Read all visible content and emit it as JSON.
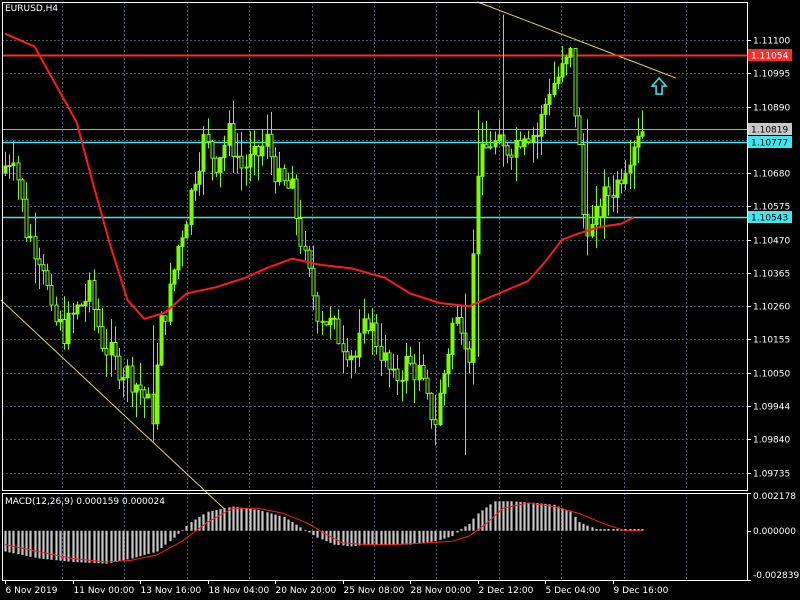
{
  "symbol_label": "EURUSD,H4",
  "colors": {
    "background": "#000000",
    "grid": "#4a5a6e",
    "axis": "#ffffff",
    "candle": "#7cfc00",
    "moving_average": "#ff1a1a",
    "trendline": "#e6d84a",
    "level_red": "#ff2a2a",
    "level_cyan": "#3fe8f0",
    "level_grey": "#a8a8a8",
    "arrow": "#2fe0e8",
    "macd_hist": "#c8c8c8",
    "macd_signal": "#ff1a1a",
    "text": "#ffffff"
  },
  "chart_data": [
    {
      "type": "candlestick",
      "title": "EURUSD,H4",
      "ylim": [
        1.0968,
        1.1122
      ],
      "y_ticks": [
        "1.11100",
        "1.10995",
        "1.10890",
        "1.10785",
        "1.10680",
        "1.10575",
        "1.10470",
        "1.10365",
        "1.10260",
        "1.10155",
        "1.10050",
        "1.09944",
        "1.09840",
        "1.09735"
      ],
      "x_ticks": [
        {
          "label": "6 Nov 2019",
          "bar": 0
        },
        {
          "label": "11 Nov 00:00",
          "bar": 16
        },
        {
          "label": "13 Nov 16:00",
          "bar": 32
        },
        {
          "label": "18 Nov 04:00",
          "bar": 48
        },
        {
          "label": "20 Nov 20:00",
          "bar": 64
        },
        {
          "label": "25 Nov 08:00",
          "bar": 80
        },
        {
          "label": "28 Nov 00:00",
          "bar": 96
        },
        {
          "label": "2 Dec 12:00",
          "bar": 112
        },
        {
          "label": "5 Dec 04:00",
          "bar": 128
        },
        {
          "label": "9 Dec 16:00",
          "bar": 144
        }
      ],
      "price_path": [
        [
          0,
          1.1068
        ],
        [
          3,
          1.1075
        ],
        [
          6,
          1.105
        ],
        [
          10,
          1.104
        ],
        [
          12,
          1.1022
        ],
        [
          15,
          1.1018
        ],
        [
          18,
          1.1025
        ],
        [
          21,
          1.103
        ],
        [
          24,
          1.1015
        ],
        [
          27,
          1.1008
        ],
        [
          30,
          1.1005
        ],
        [
          33,
          1.1
        ],
        [
          36,
          1.0992
        ],
        [
          38,
          1.102
        ],
        [
          40,
          1.103
        ],
        [
          42,
          1.1045
        ],
        [
          44,
          1.1055
        ],
        [
          46,
          1.1068
        ],
        [
          48,
          1.1078
        ],
        [
          51,
          1.1072
        ],
        [
          54,
          1.108
        ],
        [
          57,
          1.107
        ],
        [
          60,
          1.1072
        ],
        [
          63,
          1.1078
        ],
        [
          66,
          1.1065
        ],
        [
          69,
          1.1062
        ],
        [
          72,
          1.104
        ],
        [
          75,
          1.1025
        ],
        [
          78,
          1.102
        ],
        [
          81,
          1.1015
        ],
        [
          84,
          1.101
        ],
        [
          87,
          1.1022
        ],
        [
          90,
          1.1012
        ],
        [
          93,
          1.1002
        ],
        [
          96,
          1.1008
        ],
        [
          99,
          1.1005
        ],
        [
          101,
          1.0995
        ],
        [
          103,
          1.099
        ],
        [
          105,
          1.1005
        ],
        [
          107,
          1.102
        ],
        [
          109,
          1.1022
        ],
        [
          111,
          1.1012
        ],
        [
          113,
          1.107
        ],
        [
          116,
          1.1078
        ],
        [
          119,
          1.1075
        ],
        [
          122,
          1.1078
        ],
        [
          124,
          1.1082
        ],
        [
          127,
          1.108
        ],
        [
          130,
          1.1095
        ],
        [
          133,
          1.11
        ],
        [
          135,
          1.1105
        ],
        [
          136,
          1.1088
        ],
        [
          137,
          1.1075
        ],
        [
          138,
          1.1055
        ],
        [
          140,
          1.105
        ],
        [
          143,
          1.106
        ],
        [
          146,
          1.1065
        ],
        [
          149,
          1.1075
        ],
        [
          151,
          1.1082
        ]
      ],
      "bar_count": 152,
      "moving_average": [
        [
          0,
          1.1112
        ],
        [
          7,
          1.1108
        ],
        [
          12,
          1.1096
        ],
        [
          17,
          1.1084
        ],
        [
          21,
          1.1064
        ],
        [
          25,
          1.1045
        ],
        [
          29,
          1.1028
        ],
        [
          33,
          1.1022
        ],
        [
          38,
          1.1024
        ],
        [
          43,
          1.103
        ],
        [
          50,
          1.1032
        ],
        [
          57,
          1.1035
        ],
        [
          62,
          1.1038
        ],
        [
          68,
          1.1041
        ],
        [
          75,
          1.1039
        ],
        [
          82,
          1.1038
        ],
        [
          90,
          1.1035
        ],
        [
          96,
          1.103
        ],
        [
          103,
          1.1027
        ],
        [
          110,
          1.1026
        ],
        [
          117,
          1.103
        ],
        [
          124,
          1.1034
        ],
        [
          128,
          1.104
        ],
        [
          132,
          1.1047
        ],
        [
          136,
          1.1049
        ],
        [
          141,
          1.1051
        ],
        [
          146,
          1.1052
        ],
        [
          149,
          1.1054
        ]
      ],
      "trendlines": [
        {
          "from": [
            -1,
            1.1028
          ],
          "to": [
            52,
            1.0962
          ]
        },
        {
          "from": [
            112,
            1.1122
          ],
          "to": [
            159,
            1.1098
          ]
        }
      ],
      "levels": [
        {
          "value": 1.11054,
          "label": "1.11054",
          "style": "red"
        },
        {
          "value": 1.10819,
          "label": "1.10819",
          "style": "grey"
        },
        {
          "value": 1.10777,
          "label": "1.10777",
          "style": "cyan"
        },
        {
          "value": 1.10543,
          "label": "1.10543",
          "style": "cyan"
        }
      ],
      "arrow": {
        "bar": 155,
        "value": 1.1098,
        "direction": "up"
      }
    },
    {
      "type": "bar",
      "title": "MACD(12,26,9) 0.000159 0.000024",
      "ylim": [
        -0.002839,
        0.002178
      ],
      "y_ticks": [
        "0.002178",
        "0.000000",
        "-0.002839"
      ],
      "histogram_path": [
        [
          0,
          -0.0012
        ],
        [
          8,
          -0.0016
        ],
        [
          16,
          -0.0018
        ],
        [
          24,
          -0.0019
        ],
        [
          30,
          -0.0016
        ],
        [
          36,
          -0.0012
        ],
        [
          40,
          -0.0004
        ],
        [
          44,
          0.0005
        ],
        [
          48,
          0.0011
        ],
        [
          54,
          0.0014
        ],
        [
          60,
          0.0012
        ],
        [
          66,
          0.0008
        ],
        [
          70,
          0.0002
        ],
        [
          74,
          -0.0004
        ],
        [
          78,
          -0.0008
        ],
        [
          82,
          -0.0009
        ],
        [
          86,
          -0.0008
        ],
        [
          90,
          -0.0008
        ],
        [
          96,
          -0.0008
        ],
        [
          102,
          -0.0006
        ],
        [
          106,
          -0.0003
        ],
        [
          108,
          0.0001
        ],
        [
          110,
          0.0004
        ],
        [
          112,
          0.001
        ],
        [
          116,
          0.0017
        ],
        [
          120,
          0.0017
        ],
        [
          126,
          0.0016
        ],
        [
          130,
          0.0015
        ],
        [
          134,
          0.0011
        ],
        [
          136,
          0.0005
        ],
        [
          140,
          0.0001
        ],
        [
          144,
          0.0001
        ],
        [
          148,
          0.0001
        ],
        [
          151,
          0.0001
        ]
      ],
      "signal_line": [
        [
          0,
          -0.0008
        ],
        [
          8,
          -0.0012
        ],
        [
          16,
          -0.0016
        ],
        [
          24,
          -0.0018
        ],
        [
          30,
          -0.0017
        ],
        [
          36,
          -0.0014
        ],
        [
          42,
          -0.0006
        ],
        [
          48,
          0.0005
        ],
        [
          54,
          0.0013
        ],
        [
          60,
          0.0013
        ],
        [
          66,
          0.001
        ],
        [
          72,
          0.0004
        ],
        [
          76,
          -0.0002
        ],
        [
          80,
          -0.0007
        ],
        [
          86,
          -0.0008
        ],
        [
          92,
          -0.0008
        ],
        [
          100,
          -0.0007
        ],
        [
          106,
          -0.0006
        ],
        [
          110,
          -0.0003
        ],
        [
          114,
          0.0004
        ],
        [
          118,
          0.0013
        ],
        [
          124,
          0.0016
        ],
        [
          130,
          0.0014
        ],
        [
          136,
          0.001
        ],
        [
          142,
          0.0004
        ],
        [
          147,
          0.0
        ],
        [
          151,
          0.0
        ]
      ]
    }
  ]
}
